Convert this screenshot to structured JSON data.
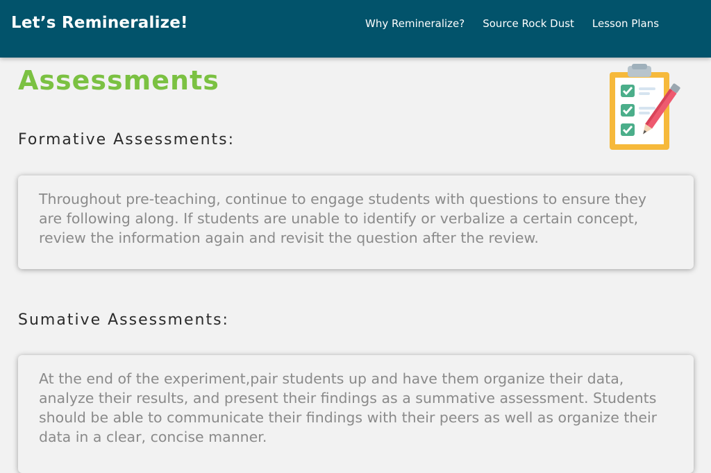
{
  "nav": {
    "brand": "Let’s Remineralize!",
    "links": [
      {
        "label": "Why Remineralize?"
      },
      {
        "label": "Source Rock Dust"
      },
      {
        "label": "Lesson Plans"
      }
    ]
  },
  "page": {
    "title": "Assessments",
    "icon": "clipboard-checklist-icon",
    "colors": {
      "header": "#02536b",
      "title": "#7bc142"
    }
  },
  "sections": [
    {
      "heading": "Formative Assessments:",
      "text": "Throughout pre-teaching, continue to engage students with questions to ensure they are following along. If students are unable to identify or verbalize a certain concept, review the information again and revisit the question after the review."
    },
    {
      "heading": "Sumative Assessments:",
      "text": "At the end of the experiment,pair students up and have them organize their data, analyze their results, and present their findings as a summative assessment. Students should be able to communicate their findings with their peers as well as organize their data in a clear, concise manner."
    }
  ]
}
